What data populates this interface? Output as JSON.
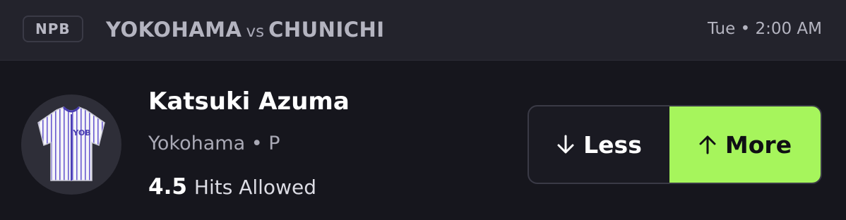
{
  "header": {
    "league": "NPB",
    "home_team": "YOKOHAMA",
    "vs": "vs",
    "away_team": "CHUNICHI",
    "game_time": "Tue • 2:00 AM"
  },
  "player": {
    "name": "Katsuki Azuma",
    "team_position": "Yokohama • P",
    "jersey_text": "YOB",
    "line_value": "4.5",
    "stat_label": "Hits Allowed"
  },
  "picks": {
    "less_label": "Less",
    "less_icon": "arrow-down-icon",
    "more_label": "More",
    "more_icon": "arrow-up-icon",
    "selected": "more"
  },
  "colors": {
    "background": "#16161d",
    "header_background": "#23232c",
    "accent_green": "#a6f55c",
    "jersey_stripe": "#6a5ad0"
  }
}
